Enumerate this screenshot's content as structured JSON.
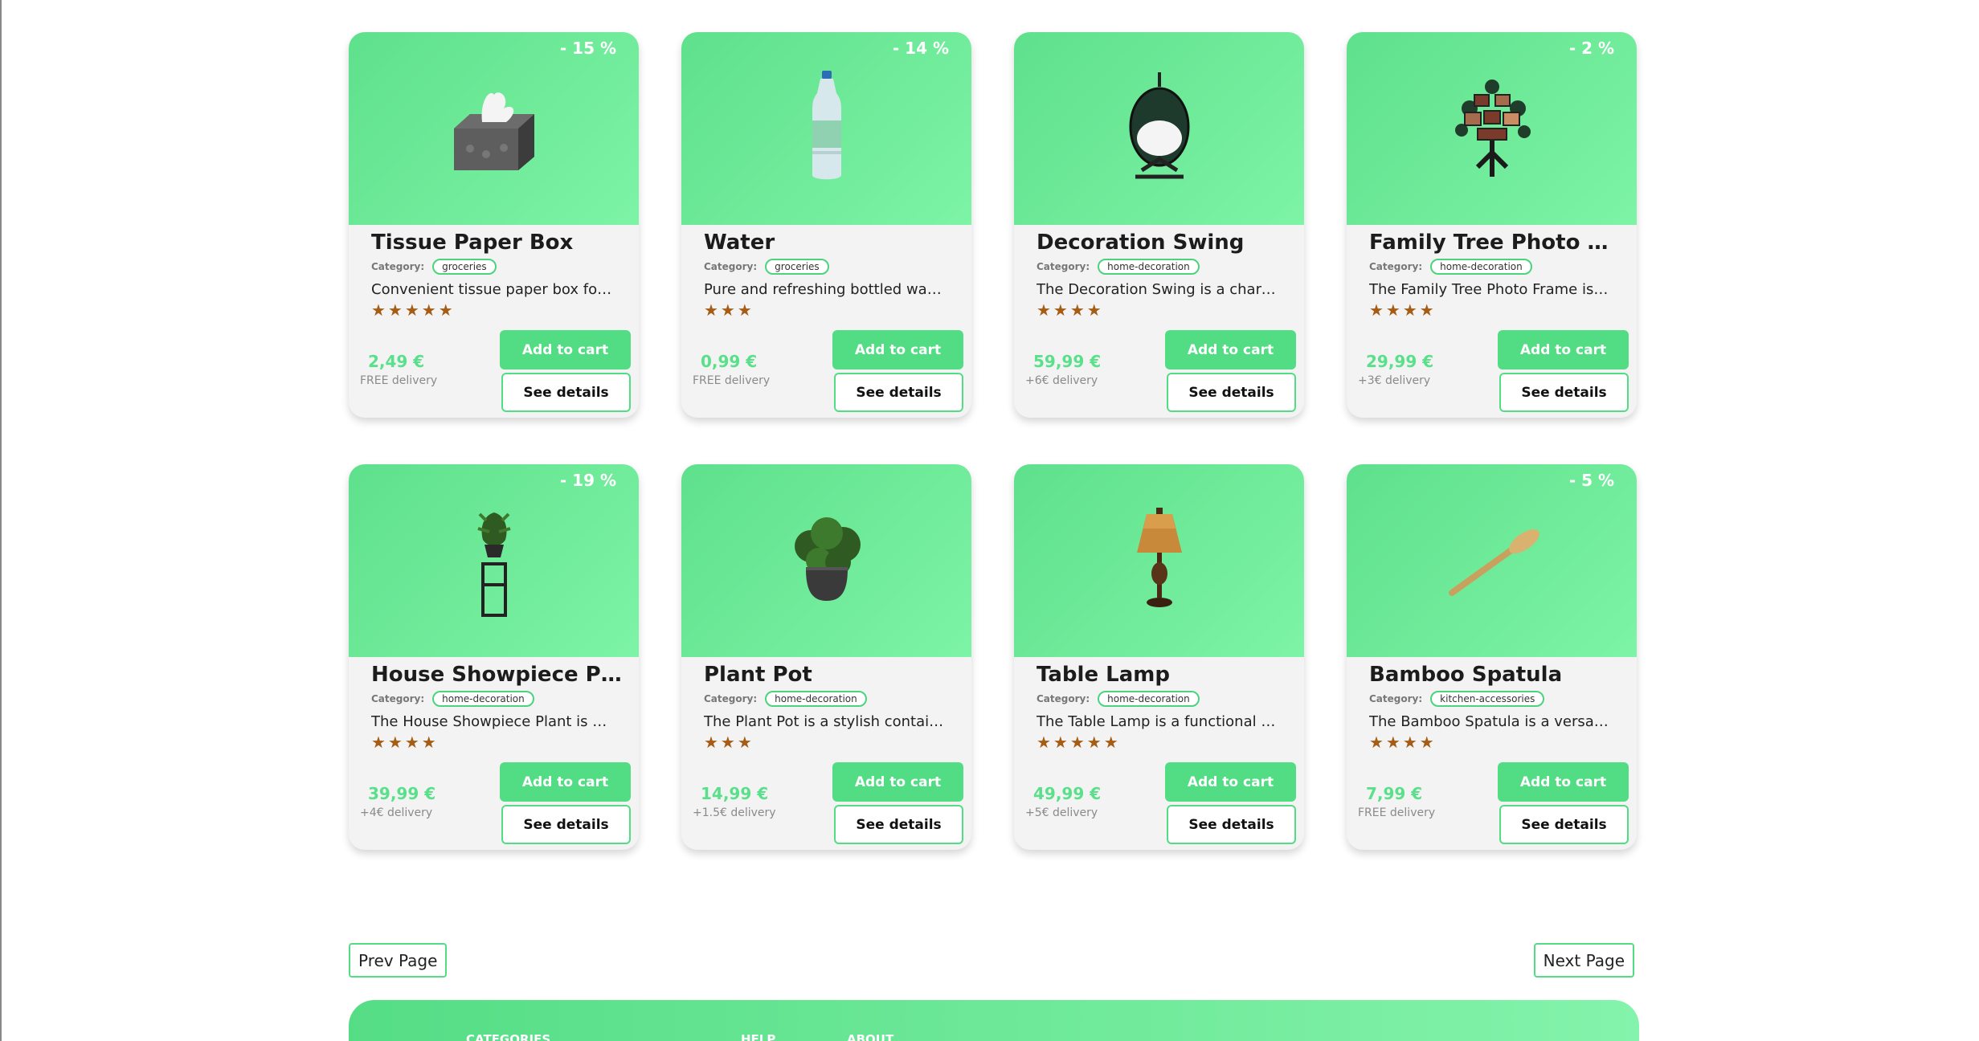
{
  "products": [
    {
      "name": "Tissue Paper Box",
      "discount": "- 15 %",
      "category_label": "Category:",
      "category": "groceries",
      "description": "Convenient tissue paper box for ...",
      "stars": "★★★★★",
      "price": "2,49 €",
      "delivery": "FREE delivery",
      "add_label": "Add to cart",
      "details_label": "See details",
      "image": "tissue-box-icon"
    },
    {
      "name": "Water",
      "discount": "- 14 %",
      "category_label": "Category:",
      "category": "groceries",
      "description": "Pure and refreshing bottled wate...",
      "stars": "★★★",
      "price": "0,99 €",
      "delivery": "FREE delivery",
      "add_label": "Add to cart",
      "details_label": "See details",
      "image": "water-bottle-icon"
    },
    {
      "name": "Decoration Swing",
      "discount": "",
      "category_label": "Category:",
      "category": "home-decoration",
      "description": "The Decoration Swing is a charm...",
      "stars": "★★★★",
      "price": "59,99 €",
      "delivery": "+6€ delivery",
      "add_label": "Add to cart",
      "details_label": "See details",
      "image": "swing-chair-icon"
    },
    {
      "name": "Family Tree Photo Fra...",
      "discount": "- 2 %",
      "category_label": "Category:",
      "category": "home-decoration",
      "description": "The Family Tree Photo Frame is a...",
      "stars": "★★★★",
      "price": "29,99 €",
      "delivery": "+3€ delivery",
      "add_label": "Add to cart",
      "details_label": "See details",
      "image": "photo-tree-icon"
    },
    {
      "name": "House Showpiece Plant",
      "discount": "- 19 %",
      "category_label": "Category:",
      "category": "home-decoration",
      "description": "The House Showpiece Plant is an...",
      "stars": "★★★★",
      "price": "39,99 €",
      "delivery": "+4€ delivery",
      "add_label": "Add to cart",
      "details_label": "See details",
      "image": "plant-stand-icon"
    },
    {
      "name": "Plant Pot",
      "discount": "",
      "category_label": "Category:",
      "category": "home-decoration",
      "description": "The Plant Pot is a stylish containe...",
      "stars": "★★★",
      "price": "14,99 €",
      "delivery": "+1.5€ delivery",
      "add_label": "Add to cart",
      "details_label": "See details",
      "image": "plant-pot-icon"
    },
    {
      "name": "Table Lamp",
      "discount": "",
      "category_label": "Category:",
      "category": "home-decoration",
      "description": "The Table Lamp is a functional a...",
      "stars": "★★★★★",
      "price": "49,99 €",
      "delivery": "+5€ delivery",
      "add_label": "Add to cart",
      "details_label": "See details",
      "image": "table-lamp-icon"
    },
    {
      "name": "Bamboo Spatula",
      "discount": "- 5 %",
      "category_label": "Category:",
      "category": "kitchen-accessories",
      "description": "The Bamboo Spatula is a versatil...",
      "stars": "★★★★",
      "price": "7,99 €",
      "delivery": "FREE delivery",
      "add_label": "Add to cart",
      "details_label": "See details",
      "image": "spatula-icon"
    }
  ],
  "pagination": {
    "prev": "Prev Page",
    "next": "Next Page"
  },
  "footer": {
    "categories": "CATEGORIES",
    "help": "HELP",
    "about": "ABOUT"
  }
}
